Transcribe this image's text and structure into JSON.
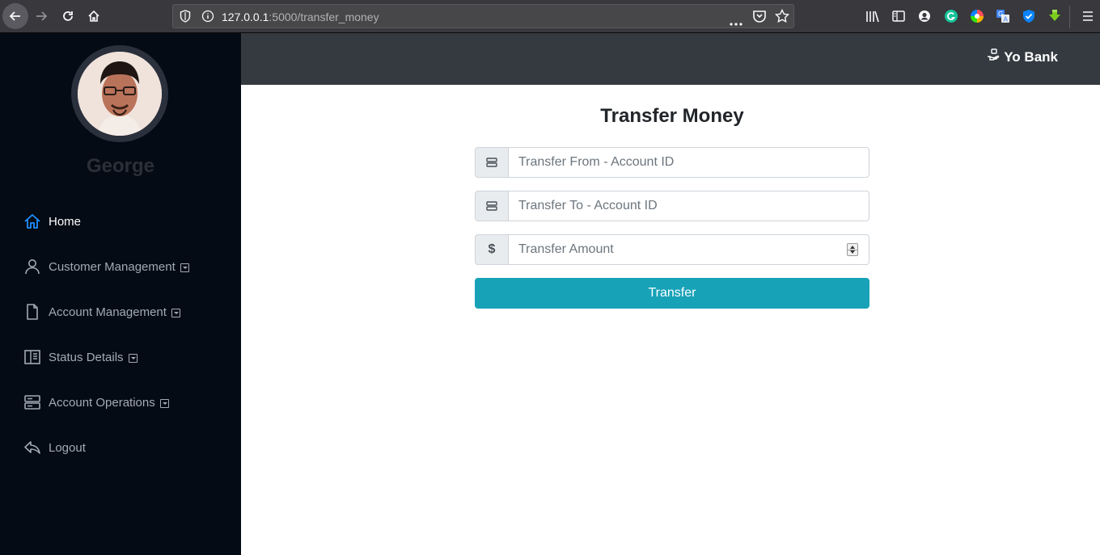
{
  "browser": {
    "url_host": "127.0.0.1",
    "url_path": ":5000/transfer_money",
    "more_label": "•••"
  },
  "sidebar": {
    "user_name": "George",
    "items": [
      {
        "label": "Home",
        "icon": "home-icon",
        "active": true,
        "dropdown": false
      },
      {
        "label": "Customer Management",
        "icon": "user-icon",
        "active": false,
        "dropdown": true
      },
      {
        "label": "Account Management",
        "icon": "document-icon",
        "active": false,
        "dropdown": true
      },
      {
        "label": "Status Details",
        "icon": "panel-icon",
        "active": false,
        "dropdown": true
      },
      {
        "label": "Account Operations",
        "icon": "server-icon",
        "active": false,
        "dropdown": true
      },
      {
        "label": "Logout",
        "icon": "reply-icon",
        "active": false,
        "dropdown": false
      }
    ]
  },
  "topbar": {
    "brand": "Yo Bank"
  },
  "form": {
    "title": "Transfer Money",
    "from_placeholder": "Transfer From - Account ID",
    "to_placeholder": "Transfer To - Account ID",
    "amount_placeholder": "Transfer Amount",
    "amount_prefix": "$",
    "submit_label": "Transfer"
  },
  "colors": {
    "sidebar_bg": "#040b14",
    "topbar_bg": "#343a40",
    "accent": "#17a2b8",
    "active_icon": "#1e90ff"
  }
}
